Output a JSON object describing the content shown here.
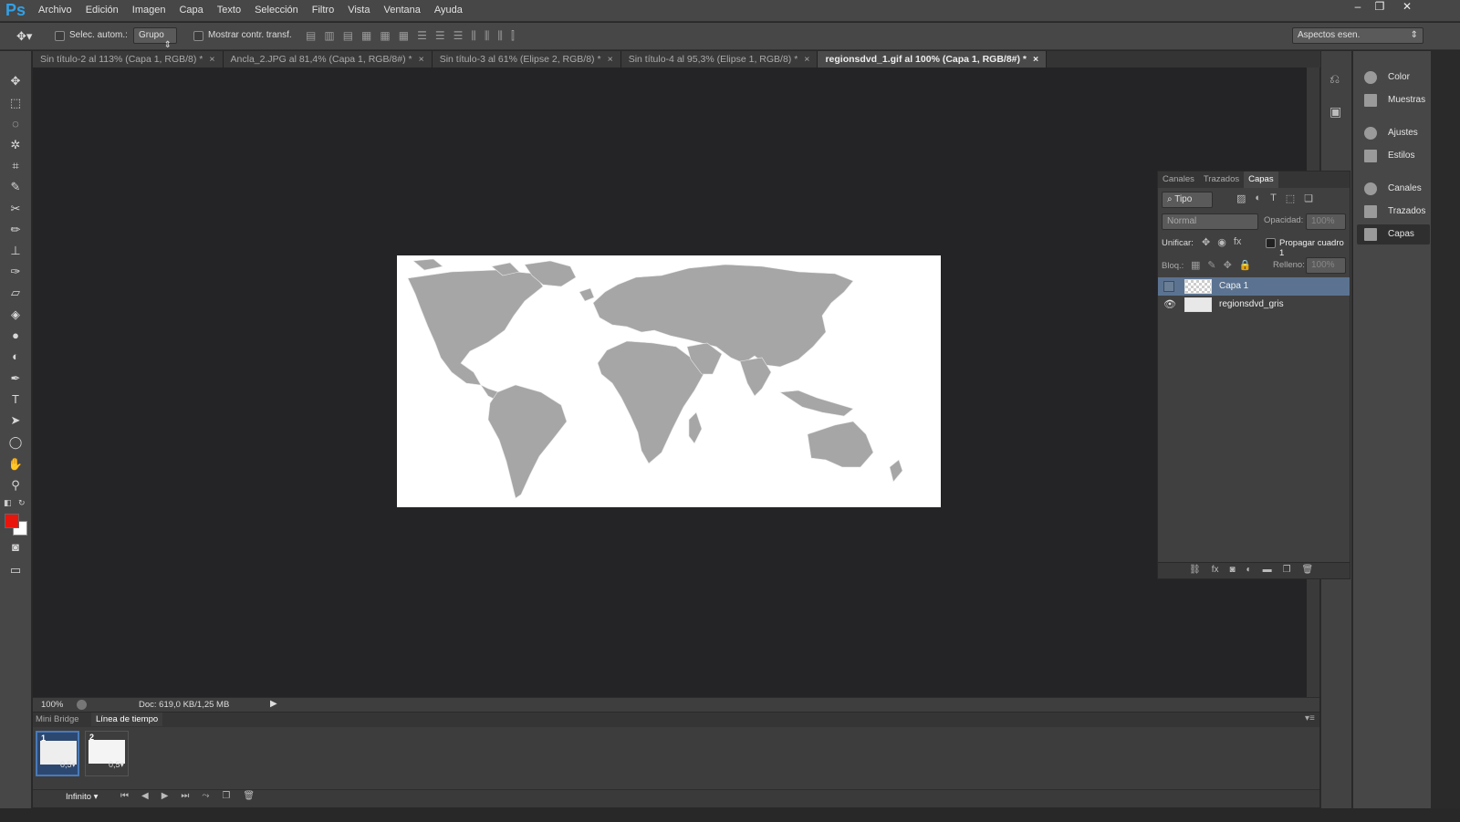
{
  "app": {
    "logo": "Ps"
  },
  "menu": [
    "Archivo",
    "Edición",
    "Imagen",
    "Capa",
    "Texto",
    "Selección",
    "Filtro",
    "Vista",
    "Ventana",
    "Ayuda"
  ],
  "window_controls": {
    "minimize": "–",
    "restore": "❐",
    "close": "✕"
  },
  "options": {
    "auto_select_label": "Selec. autom.:",
    "auto_select_value": "Grupo",
    "show_transform_label": "Mostrar contr. transf.",
    "workspace": "Aspectos esen."
  },
  "tabs": [
    {
      "label": "Sin título-2 al 113% (Capa 1, RGB/8) *"
    },
    {
      "label": "Ancla_2.JPG al 81,4% (Capa 1, RGB/8#) *"
    },
    {
      "label": "Sin título-3 al 61% (Elipse 2, RGB/8) *"
    },
    {
      "label": "Sin título-4 al 95,3% (Elipse 1, RGB/8) *"
    },
    {
      "label": "regionsdvd_1.gif al 100% (Capa 1, RGB/8#) *"
    }
  ],
  "tab_close": "×",
  "colors": {
    "foreground": "#e8150d",
    "background": "#ffffff",
    "accent": "#32a0e6",
    "selection": "#5b7391"
  },
  "status": {
    "zoom": "100%",
    "doc": "Doc: 619,0 KB/1,25 MB"
  },
  "dock": {
    "items": [
      {
        "label": "Color",
        "icon": "color-icon"
      },
      {
        "label": "Muestras",
        "icon": "swatches-icon"
      },
      {
        "label": "Ajustes",
        "icon": "adjustments-icon"
      },
      {
        "label": "Estilos",
        "icon": "styles-icon"
      },
      {
        "label": "Canales",
        "icon": "channels-icon"
      },
      {
        "label": "Trazados",
        "icon": "paths-icon"
      },
      {
        "label": "Capas",
        "icon": "layers-icon"
      }
    ]
  },
  "layers_panel": {
    "tabs": [
      "Canales",
      "Trazados",
      "Capas"
    ],
    "active_tab": "Capas",
    "filter": "Tipo",
    "blend_mode": "Normal",
    "opacity_label": "Opacidad:",
    "opacity_value": "100%",
    "unify_label": "Unificar:",
    "propagate_label": "Propagar cuadro 1",
    "lock_label": "Bloq.:",
    "fill_label": "Relleno:",
    "fill_value": "100%",
    "layers": [
      {
        "name": "Capa 1",
        "selected": true,
        "visible": false
      },
      {
        "name": "regionsdvd_gris",
        "selected": false,
        "visible": true
      }
    ]
  },
  "timeline": {
    "tabs": [
      "Mini Bridge",
      "Línea de tiempo"
    ],
    "active_tab": "Línea de tiempo",
    "frames": [
      {
        "num": "1",
        "delay": "0,5"
      },
      {
        "num": "2",
        "delay": "0,5"
      }
    ],
    "loop": "Infinito"
  }
}
